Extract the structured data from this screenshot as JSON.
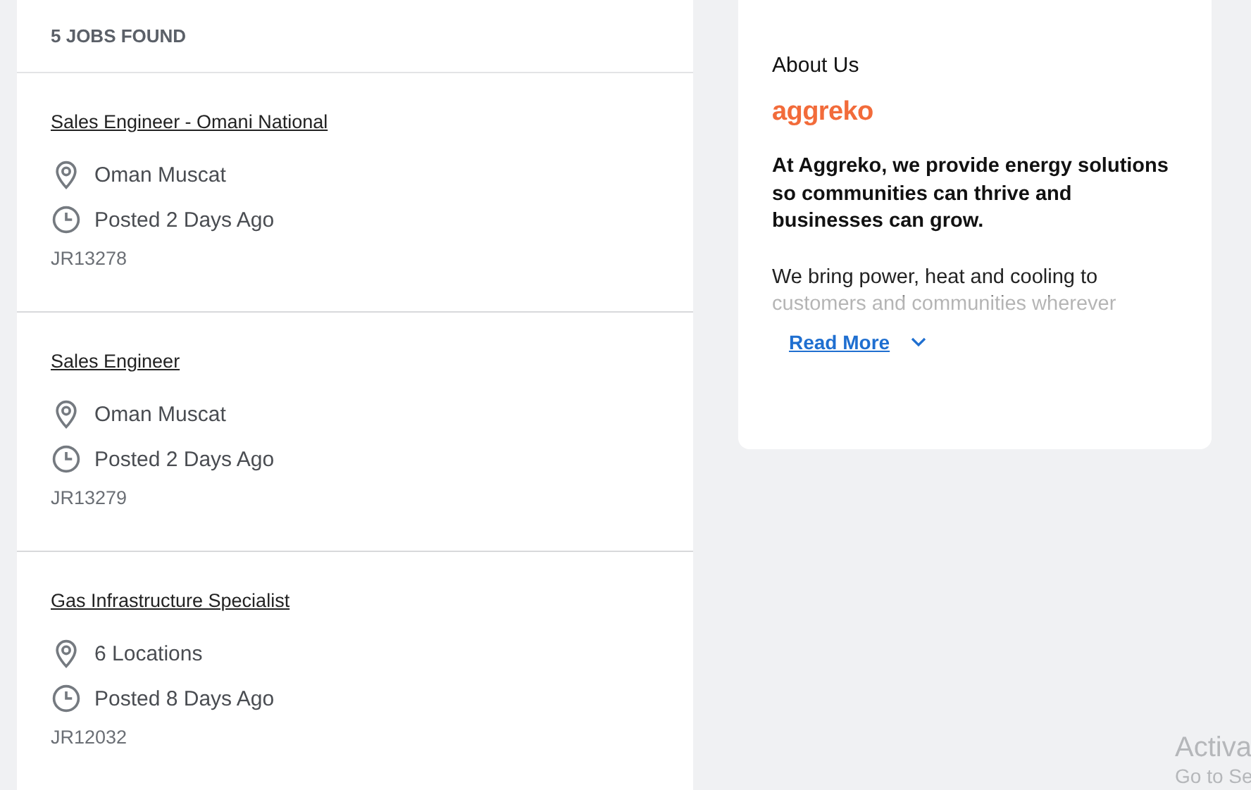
{
  "results": {
    "count_label": "5 JOBS FOUND",
    "jobs": [
      {
        "title": "Sales Engineer - Omani National",
        "location": "Oman Muscat",
        "posted": "Posted 2 Days Ago",
        "id": "JR13278"
      },
      {
        "title": "Sales Engineer",
        "location": "Oman Muscat",
        "posted": "Posted 2 Days Ago",
        "id": "JR13279"
      },
      {
        "title": "Gas Infrastructure Specialist",
        "location": "6 Locations",
        "posted": "Posted 8 Days Ago",
        "id": "JR12032"
      }
    ]
  },
  "about": {
    "heading": "About Us",
    "logo": "aggreko",
    "lead": "At Aggreko, we provide energy solutions so communities can thrive and businesses can grow.",
    "body": "We bring power, heat and cooling to customers and communities wherever",
    "read_more": "Read More"
  },
  "os_overlay": {
    "title": "Activa",
    "subtitle": "Go to Se"
  }
}
